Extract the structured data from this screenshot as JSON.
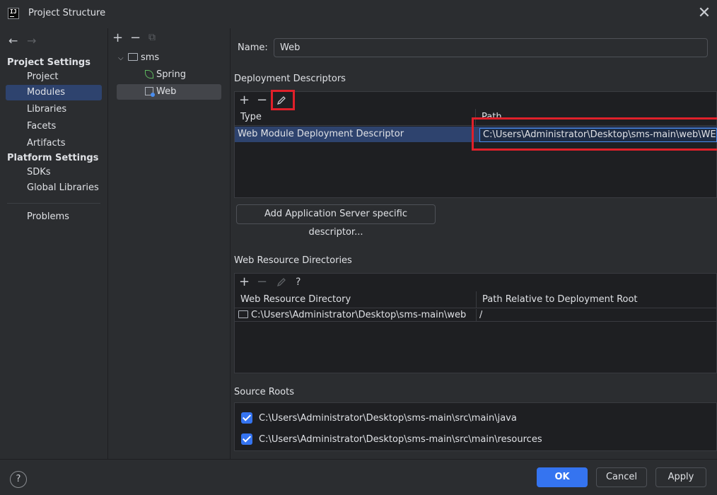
{
  "window": {
    "title": "Project Structure",
    "close_label": "✕",
    "app_icon_text": "IJ"
  },
  "sidebar": {
    "back_label": "←",
    "forward_label": "→",
    "project_settings_heading": "Project Settings",
    "project_items": [
      "Project",
      "Modules",
      "Libraries",
      "Facets",
      "Artifacts"
    ],
    "platform_settings_heading": "Platform Settings",
    "platform_items": [
      "SDKs",
      "Global Libraries"
    ],
    "problems_label": "Problems",
    "selected": "Modules"
  },
  "tree": {
    "add_label": "+",
    "remove_label": "−",
    "copy_label": "⧉",
    "root": "sms",
    "children": [
      "Spring",
      "Web"
    ],
    "selected": "Web"
  },
  "content": {
    "name_label": "Name:",
    "name_value": "Web",
    "deployment": {
      "heading": "Deployment Descriptors",
      "add_label": "+",
      "remove_label": "−",
      "columns": [
        "Type",
        "Path"
      ],
      "rows": [
        {
          "type": "Web Module Deployment Descriptor",
          "path": "C:\\Users\\Administrator\\Desktop\\sms-main\\web\\WEB-INF\\web.xml"
        }
      ],
      "add_server_descriptor_label": "Add Application Server specific descriptor..."
    },
    "web_resources": {
      "heading": "Web Resource Directories",
      "add_label": "+",
      "remove_label": "−",
      "help_label": "?",
      "columns": [
        "Web Resource Directory",
        "Path Relative to Deployment Root"
      ],
      "rows": [
        {
          "dir": "C:\\Users\\Administrator\\Desktop\\sms-main\\web",
          "rel": "/"
        }
      ]
    },
    "source_roots": {
      "heading": "Source Roots",
      "items": [
        {
          "path": "C:\\Users\\Administrator\\Desktop\\sms-main\\src\\main\\java",
          "checked": true
        },
        {
          "path": "C:\\Users\\Administrator\\Desktop\\sms-main\\src\\main\\resources",
          "checked": true
        }
      ]
    }
  },
  "footer": {
    "help_label": "?",
    "ok_label": "OK",
    "cancel_label": "Cancel",
    "apply_label": "Apply"
  },
  "colors": {
    "accent": "#3574f0",
    "selection": "#2e436e",
    "highlight": "#e0202a",
    "background": "#2b2d30",
    "panel": "#1e1f22"
  }
}
